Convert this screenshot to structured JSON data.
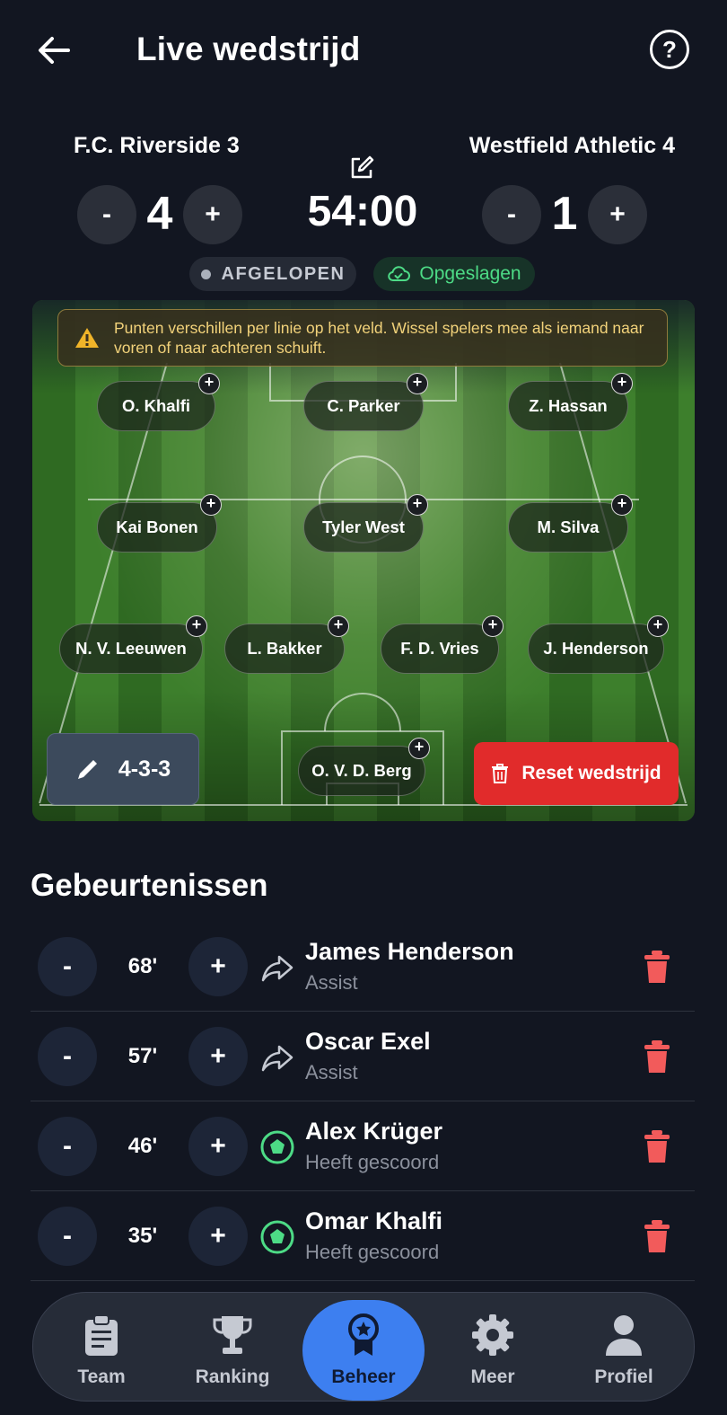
{
  "header": {
    "title": "Live wedstrijd"
  },
  "match": {
    "home_team": "F.C. Riverside 3",
    "away_team": "Westfield Athletic 4",
    "home_score": "4",
    "away_score": "1",
    "clock": "54:00",
    "status": "AFGELOPEN",
    "saved": "Opgeslagen",
    "minus_label": "-",
    "plus_label": "+"
  },
  "pitch": {
    "warning": "Punten verschillen per linie op het veld. Wissel spelers mee als iemand naar voren of naar achteren schuift.",
    "players": {
      "fw_left": "O. Khalfi",
      "fw_center": "C. Parker",
      "fw_right": "Z. Hassan",
      "mf_left": "Kai Bonen",
      "mf_center": "Tyler West",
      "mf_right": "M. Silva",
      "df_1": "N. V. Leeuwen",
      "df_2": "L. Bakker",
      "df_3": "F. D. Vries",
      "df_4": "J. Henderson",
      "gk": "O. V. D. Berg"
    },
    "add_label": "+",
    "formation": "4-3-3",
    "reset_label": "Reset wedstrijd"
  },
  "events": {
    "title": "Gebeurtenissen",
    "items": [
      {
        "minute": "68'",
        "name": "James Henderson",
        "type": "Assist",
        "icon": "assist-icon"
      },
      {
        "minute": "57'",
        "name": "Oscar Exel",
        "type": "Assist",
        "icon": "assist-icon"
      },
      {
        "minute": "46'",
        "name": "Alex Krüger",
        "type": "Heeft gescoord",
        "icon": "goal-icon"
      },
      {
        "minute": "35'",
        "name": "Omar Khalfi",
        "type": "Heeft gescoord",
        "icon": "goal-icon"
      }
    ]
  },
  "nav": {
    "team": "Team",
    "ranking": "Ranking",
    "beheer": "Beheer",
    "meer": "Meer",
    "profiel": "Profiel",
    "active": "Beheer"
  },
  "colors": {
    "background": "#121621",
    "accent": "#3d7ff0",
    "danger": "#e12b2b",
    "success": "#4ddb86",
    "warning": "#f2d27a"
  }
}
